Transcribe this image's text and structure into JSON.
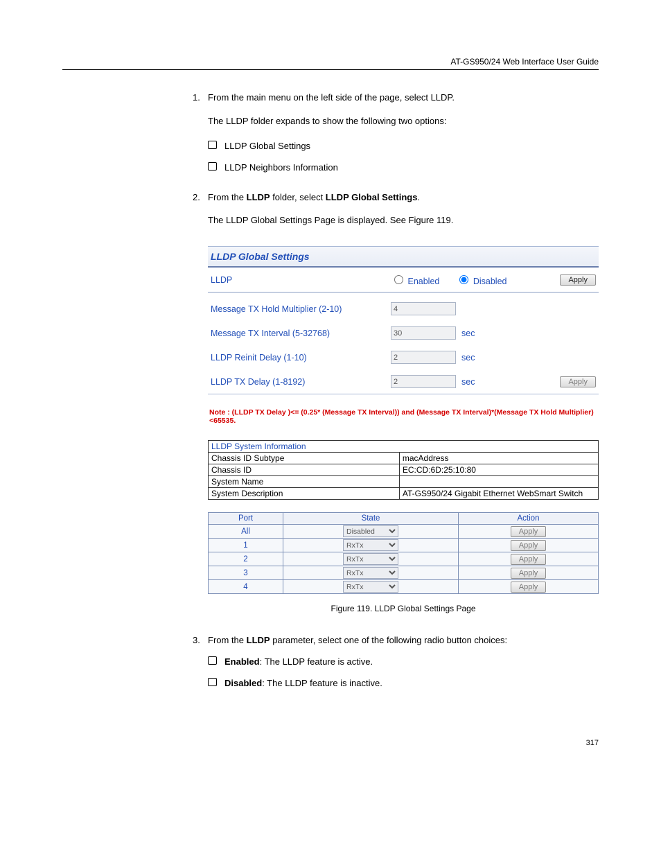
{
  "header": {
    "right": "AT-GS950/24 Web Interface User Guide"
  },
  "step1": {
    "num": "1.",
    "intro": "From the main menu on the left side of the page, select LLDP.",
    "sub": "The LLDP folder expands to show the following two options:",
    "opt1": "LLDP Global Settings",
    "opt2": "LLDP Neighbors Information"
  },
  "step2": {
    "num": "2.",
    "text1": "From the ",
    "bold1": "LLDP",
    "text2": " folder, select ",
    "bold2": "LLDP Global Settings",
    "text3": "."
  },
  "step2_post": "The LLDP Global Settings Page is displayed. See Figure 119.",
  "panel": {
    "title": "LLDP Global Settings",
    "lldp_label": "LLDP",
    "enabled": "Enabled",
    "disabled": "Disabled",
    "apply": "Apply",
    "r1_label": "Message TX Hold Multiplier   (2-10)",
    "r1_val": "4",
    "r2_label": "Message TX Interval   (5-32768)",
    "r2_val": "30",
    "r3_label": "LLDP Reinit Delay   (1-10)",
    "r3_val": "2",
    "r4_label": "LLDP TX Delay   (1-8192)",
    "r4_val": "2",
    "sec_unit": "sec"
  },
  "note": "Note : (LLDP TX Delay )<= (0.25* (Message TX Interval))   and   (Message TX Interval)*(Message TX Hold Multiplier)<65535.",
  "sysinfo": {
    "title": "LLDP System Information",
    "r1k": "Chassis ID Subtype",
    "r1v": "macAddress",
    "r2k": "Chassis ID",
    "r2v": "EC:CD:6D:25:10:80",
    "r3k": "System Name",
    "r3v": "",
    "r4k": "System Description",
    "r4v": "AT-GS950/24 Gigabit Ethernet WebSmart Switch"
  },
  "porttable": {
    "h1": "Port",
    "h2": "State",
    "h3": "Action",
    "all_label": "All",
    "all_state": "Disabled",
    "rxtx": "RxTx",
    "rows": [
      "1",
      "2",
      "3",
      "4"
    ]
  },
  "fig_caption": "Figure 119. LLDP Global Settings Page",
  "step3": {
    "num": "3.",
    "pre": "From the ",
    "bold": "LLDP",
    "post": " parameter, select one of the following radio button choices:"
  },
  "step3_bullets": {
    "b1a": "Enabled",
    "b1b": ": The LLDP feature is active.",
    "b2a": "Disabled",
    "b2b": ": The LLDP feature is inactive."
  },
  "pagenum": "317"
}
